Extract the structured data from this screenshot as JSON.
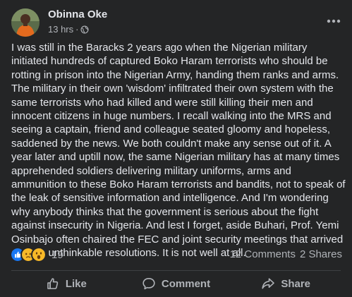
{
  "post": {
    "author_name": "Obinna Oke",
    "timestamp": "13 hrs",
    "separator": "·",
    "audience_icon": "globe-icon",
    "menu_icon": "more-horizontal-icon",
    "body": "I was still in the Baracks 2 years ago when the Nigerian military initiated hundreds of captured Boko Haram terrorists who should be rotting in prison into the Nigerian Army, handing them ranks and arms. The military in their own 'wisdom' infiltrated their own system with the same terrorists who had killed and were still killing their men and innocent citizens in huge numbers. I recall walking into the MRS and seeing a captain, friend and colleague seated gloomy and hopeless, saddened by the news. We both couldn't make any sense out of it. A year later and uptill now, the same Nigerian military has at many times apprehended soldiers delivering military uniforms, arms and ammunition to these Boko Haram terrorists and bandits, not to speak of the leak of sensitive information and intelligence. And I'm wondering why anybody thinks that the government is serious about the fight against insecurity in Nigeria. And lest I forget, aside Buhari, Prof. Yemi Osinbajo often chaired the FEC and joint security meetings that arrived at such unthinkable resolutions. It is not well at all."
  },
  "reactions": {
    "icons": [
      "like-reaction-icon",
      "sad-reaction-icon",
      "wow-reaction-icon"
    ],
    "count": "19"
  },
  "stats": {
    "comments": "12 Comments",
    "shares": "2 Shares"
  },
  "actions": {
    "like_label": "Like",
    "comment_label": "Comment",
    "share_label": "Share"
  },
  "colors": {
    "background": "#242526",
    "primary_text": "#e4e6eb",
    "secondary_text": "#b0b3b8",
    "like_blue": "#1877f2",
    "reaction_yellow": "#f7b928"
  }
}
